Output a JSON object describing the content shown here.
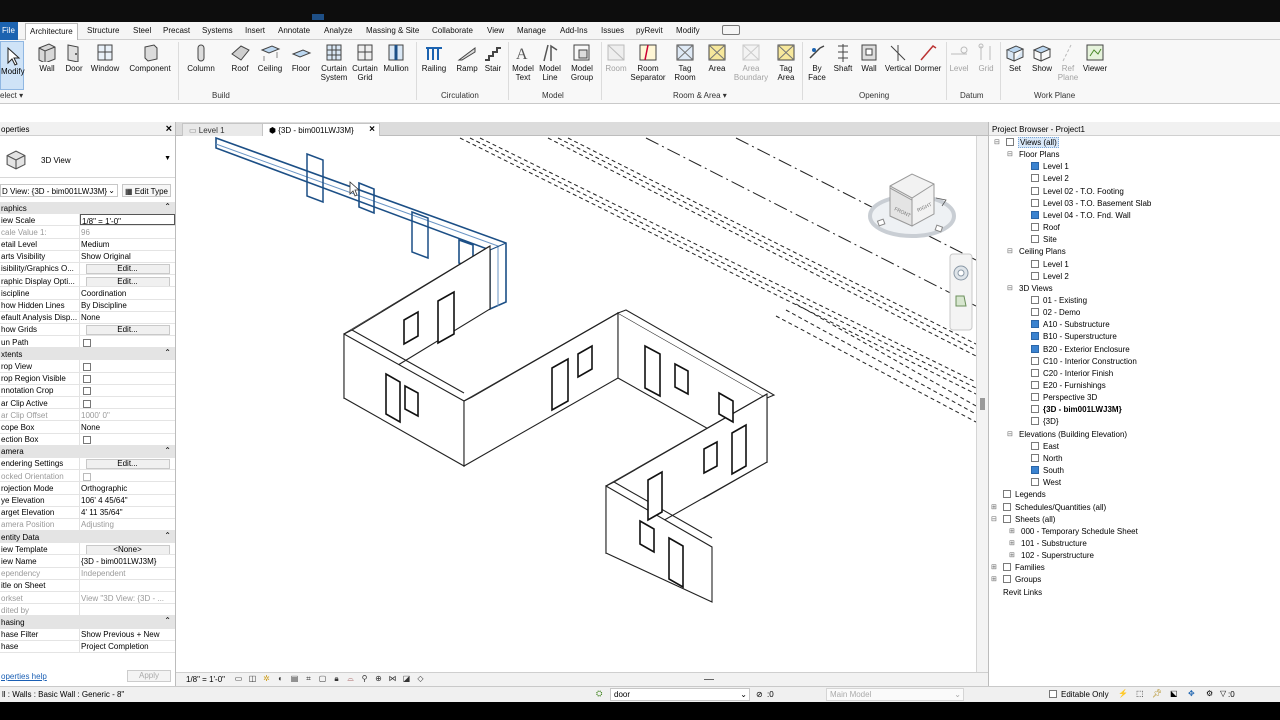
{
  "ribbon_tabs": [
    "File",
    "Architecture",
    "Structure",
    "Steel",
    "Precast",
    "Systems",
    "Insert",
    "Annotate",
    "Analyze",
    "Massing & Site",
    "Collaborate",
    "View",
    "Manage",
    "Add-Ins",
    "Issues",
    "pyRevit",
    "Modify"
  ],
  "active_tab": "Architecture",
  "ribbon_buttons": {
    "modify": "Modify",
    "wall": "Wall",
    "door": "Door",
    "window": "Window",
    "component": "Component",
    "column": "Column",
    "roof": "Roof",
    "ceiling": "Ceiling",
    "floor": "Floor",
    "curtain_system": [
      "Curtain",
      "System"
    ],
    "curtain_grid": [
      "Curtain",
      "Grid"
    ],
    "mullion": "Mullion",
    "railing": "Railing",
    "ramp": "Ramp",
    "stair": "Stair",
    "model_text": [
      "Model",
      "Text"
    ],
    "model_line": [
      "Model",
      "Line"
    ],
    "model_group": [
      "Model",
      "Group"
    ],
    "room": "Room",
    "room_separator": [
      "Room",
      "Separator"
    ],
    "tag_room": [
      "Tag",
      "Room"
    ],
    "area": "Area",
    "area_boundary": [
      "Area",
      "Boundary"
    ],
    "tag_area": [
      "Tag",
      "Area"
    ],
    "by_face": [
      "By",
      "Face"
    ],
    "shaft": "Shaft",
    "wall_opening": "Wall",
    "vertical": "Vertical",
    "dormer": "Dormer",
    "level": "Level",
    "grid": "Grid",
    "set": "Set",
    "show": "Show",
    "ref_plane": [
      "Ref",
      "Plane"
    ],
    "viewer": "Viewer"
  },
  "panel_labels": {
    "select": "elect",
    "build": "Build",
    "circulation": "Circulation",
    "model": "Model",
    "room_area": "Room & Area",
    "opening": "Opening",
    "datum": "Datum",
    "work_plane": "Work Plane"
  },
  "properties": {
    "title": "operties",
    "type_name": "3D View",
    "instance_selector": "D View: {3D - bim001LWJ3M}",
    "edit_type": "Edit Type",
    "rows": [
      {
        "k": "raphics",
        "group": true
      },
      {
        "k": "iew Scale",
        "v": "1/8\" = 1'-0\"",
        "edit": true
      },
      {
        "k": "cale Value   1:",
        "v": "96",
        "gray": true
      },
      {
        "k": "etail Level",
        "v": "Medium"
      },
      {
        "k": "arts Visibility",
        "v": "Show Original"
      },
      {
        "k": "isibility/Graphics O...",
        "btn": "Edit..."
      },
      {
        "k": "raphic Display Opti...",
        "btn": "Edit..."
      },
      {
        "k": "iscipline",
        "v": "Coordination"
      },
      {
        "k": "how Hidden Lines",
        "v": "By Discipline"
      },
      {
        "k": "efault Analysis Disp...",
        "v": "None"
      },
      {
        "k": "how Grids",
        "btn": "Edit..."
      },
      {
        "k": "un Path",
        "cb": true
      },
      {
        "k": "xtents",
        "group": true
      },
      {
        "k": "rop View",
        "cb": true
      },
      {
        "k": "rop Region Visible",
        "cb": true
      },
      {
        "k": "nnotation Crop",
        "cb": true
      },
      {
        "k": "ar Clip Active",
        "cb": true
      },
      {
        "k": "ar Clip Offset",
        "v": "1000'  0\"",
        "gray": true
      },
      {
        "k": "cope Box",
        "v": "None"
      },
      {
        "k": "ection Box",
        "cb": true
      },
      {
        "k": "amera",
        "group": true
      },
      {
        "k": "endering Settings",
        "btn": "Edit..."
      },
      {
        "k": "ocked Orientation",
        "cb": true,
        "gray": true
      },
      {
        "k": "rojection Mode",
        "v": "Orthographic"
      },
      {
        "k": "ye Elevation",
        "v": "106'  4 45/64\""
      },
      {
        "k": "arget Elevation",
        "v": "4'  11 35/64\""
      },
      {
        "k": "amera Position",
        "v": "Adjusting",
        "gray": true
      },
      {
        "k": "entity Data",
        "group": true
      },
      {
        "k": "iew Template",
        "btn": "<None>"
      },
      {
        "k": "iew Name",
        "v": "{3D - bim001LWJ3M}"
      },
      {
        "k": "ependency",
        "v": "Independent",
        "gray": true
      },
      {
        "k": "itle on Sheet",
        "v": ""
      },
      {
        "k": "orkset",
        "v": "View \"3D View: {3D - ...",
        "gray": true
      },
      {
        "k": "dited by",
        "v": "",
        "gray": true
      },
      {
        "k": "hasing",
        "group": true
      },
      {
        "k": "hase Filter",
        "v": "Show Previous + New"
      },
      {
        "k": "hase",
        "v": "Project Completion"
      }
    ],
    "help_link": "operties help",
    "apply": "Apply"
  },
  "view_tabs": [
    {
      "label": "Level 1",
      "active": false
    },
    {
      "label": "{3D - bim001LWJ3M}",
      "active": true
    }
  ],
  "view_scale": "1/8\" = 1'-0\"",
  "browser": {
    "title": "Project Browser - Project1",
    "root": "Views (all)",
    "floor_plans": "Floor Plans",
    "floor_items": [
      "Level 1",
      "Level 2",
      "Level 02 - T.O. Footing",
      "Level 03 - T.O. Basement Slab",
      "Level 04 - T.O. Fnd. Wall",
      "Roof",
      "Site"
    ],
    "ceiling_plans": "Ceiling Plans",
    "ceiling_items": [
      "Level 1",
      "Level 2"
    ],
    "views_3d": "3D Views",
    "views_3d_items": [
      "01 - Existing",
      "02 - Demo",
      "A10 - Substructure",
      "B10 - Superstructure",
      "B20 - Exterior Enclosure",
      "C10 - Interior Construction",
      "C20 - Interior Finish",
      "E20 - Furnishings",
      "Perspective 3D",
      "{3D - bim001LWJ3M}",
      "{3D}"
    ],
    "elevations": "Elevations (Building Elevation)",
    "elevation_items": [
      "East",
      "North",
      "South",
      "West"
    ],
    "legends": "Legends",
    "schedules": "Schedules/Quantities (all)",
    "sheets": "Sheets (all)",
    "sheet_items": [
      "000 - Temporary Schedule Sheet",
      "101 - Substructure",
      "102 - Superstructure"
    ],
    "families": "Families",
    "groups": "Groups",
    "revit_links": "Revit Links"
  },
  "status": {
    "message": "ll : Walls : Basic Wall : Generic - 8\"",
    "workset": "door",
    "zero": ":0",
    "main_model": "Main Model",
    "editable_only": "Editable Only",
    "filter_count": ":0"
  },
  "viewcube": {
    "front": "FRONT",
    "right": "RIGHT"
  },
  "colors": {
    "accent": "#1c63b0",
    "selection": "#3b83d0"
  }
}
